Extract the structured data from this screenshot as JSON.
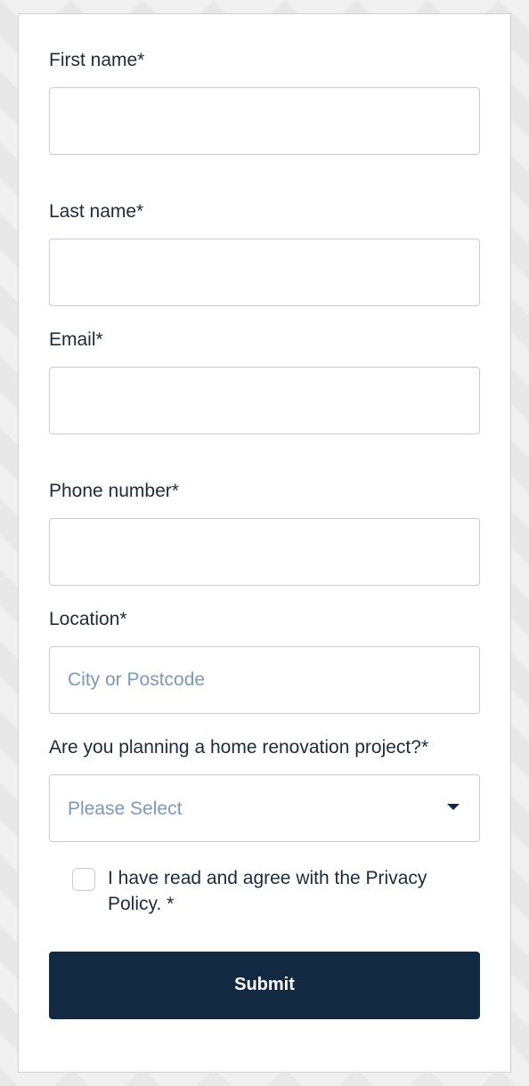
{
  "form": {
    "firstName": {
      "label": "First name*",
      "value": ""
    },
    "lastName": {
      "label": "Last name*",
      "value": ""
    },
    "email": {
      "label": "Email*",
      "value": ""
    },
    "phone": {
      "label": "Phone number*",
      "value": ""
    },
    "location": {
      "label": "Location*",
      "placeholder": "City or Postcode",
      "value": ""
    },
    "renovation": {
      "label": "Are you planning a home renovation project?*",
      "selected": "Please Select"
    },
    "consent": {
      "label": "I have read and agree with the Privacy Policy. *",
      "checked": false
    },
    "submit": {
      "label": "Submit"
    }
  }
}
